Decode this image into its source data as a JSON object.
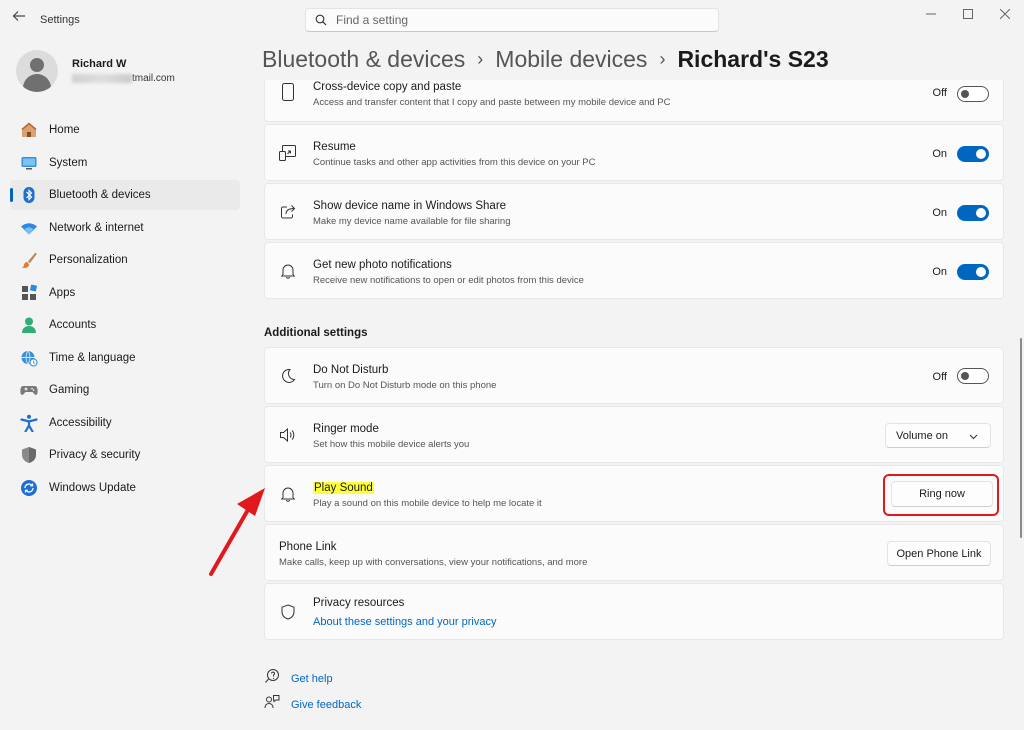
{
  "window": {
    "title": "Settings"
  },
  "search": {
    "placeholder": "Find a setting"
  },
  "user": {
    "name": "Richard W",
    "email_visible": "tmail.com"
  },
  "nav": {
    "items": [
      {
        "label": "Home",
        "icon": "home-icon"
      },
      {
        "label": "System",
        "icon": "system-icon"
      },
      {
        "label": "Bluetooth & devices",
        "icon": "bluetooth-icon",
        "active": true
      },
      {
        "label": "Network & internet",
        "icon": "wifi-icon"
      },
      {
        "label": "Personalization",
        "icon": "brush-icon"
      },
      {
        "label": "Apps",
        "icon": "apps-icon"
      },
      {
        "label": "Accounts",
        "icon": "accounts-icon"
      },
      {
        "label": "Time & language",
        "icon": "globe-icon"
      },
      {
        "label": "Gaming",
        "icon": "gamepad-icon"
      },
      {
        "label": "Accessibility",
        "icon": "accessibility-icon"
      },
      {
        "label": "Privacy & security",
        "icon": "shield-icon"
      },
      {
        "label": "Windows Update",
        "icon": "update-icon"
      }
    ]
  },
  "breadcrumb": {
    "level1": "Bluetooth & devices",
    "level2": "Mobile devices",
    "current": "Richard's S23"
  },
  "settings": {
    "cross_device": {
      "title": "Cross-device copy and paste",
      "desc": "Access and transfer content that I copy and paste between my mobile device and PC",
      "state": "Off"
    },
    "resume": {
      "title": "Resume",
      "desc": "Continue tasks and other app activities from this device on your PC",
      "state": "On"
    },
    "share_name": {
      "title": "Show device name in Windows Share",
      "desc": "Make my device name available for file sharing",
      "state": "On"
    },
    "photo_notif": {
      "title": "Get new photo notifications",
      "desc": "Receive new notifications to open or edit photos from this device",
      "state": "On"
    }
  },
  "additional": {
    "heading": "Additional settings",
    "dnd": {
      "title": "Do Not Disturb",
      "desc": "Turn on Do Not Disturb mode on this phone",
      "state": "Off"
    },
    "ringer": {
      "title": "Ringer mode",
      "desc": "Set how this mobile device alerts you",
      "value": "Volume on"
    },
    "play_sound": {
      "title": "Play Sound",
      "desc": "Play a sound on this mobile device to help me locate it",
      "button": "Ring now"
    },
    "phone_link": {
      "title": "Phone Link",
      "desc": "Make calls, keep up with conversations, view your notifications, and more",
      "button": "Open Phone Link"
    },
    "privacy": {
      "title": "Privacy resources",
      "link": "About these settings and your privacy"
    }
  },
  "footer": {
    "help": "Get help",
    "feedback": "Give feedback"
  },
  "colors": {
    "accent": "#0067c0",
    "annotation": "#e0191c",
    "highlight": "#ffff3a"
  }
}
